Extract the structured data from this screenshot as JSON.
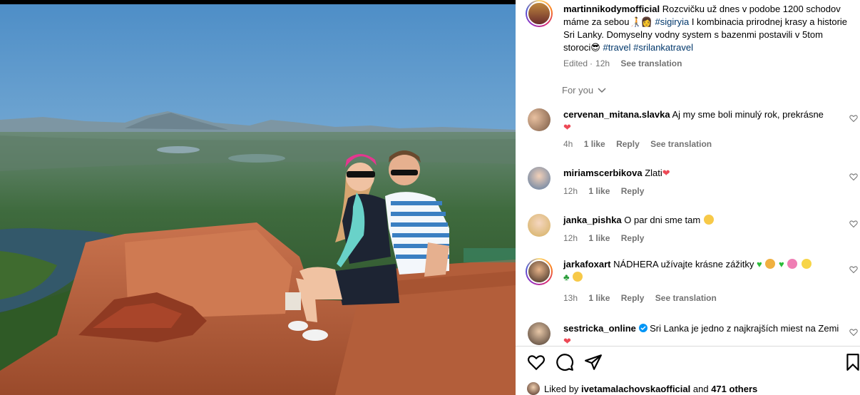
{
  "post": {
    "author": "martinnikodymofficial",
    "caption_part1": "Rozcvičku už dnes v podobe 1200 schodov máme za sebou",
    "caption_tag1": "#sigiryia",
    "caption_part2": "I kombinacia prirodnej krasy a historie Sri Lanky. Domyselny vodny system s bazenmi postavili v 5tom storoci",
    "caption_tag2": "#travel",
    "caption_tag3": "#srilankatravel",
    "edited_label": "Edited",
    "time": "12h",
    "see_translation": "See translation",
    "emoji_walkers": "🧑‍🦯",
    "emoji_woman": "👩",
    "emoji_cool": "😎"
  },
  "for_you_label": "For you",
  "comments": [
    {
      "username": "cervenan_mitana.slavka",
      "text": "Aj my sme boli minulý rok, prekrásne",
      "time": "4h",
      "likes": "1 like",
      "reply": "Reply",
      "translate": "See translation"
    },
    {
      "username": "miriamscerbikova",
      "text": "Zlati",
      "time": "12h",
      "likes": "1 like",
      "reply": "Reply"
    },
    {
      "username": "janka_pishka",
      "text": "O par dni sme tam",
      "time": "12h",
      "likes": "1 like",
      "reply": "Reply"
    },
    {
      "username": "jarkafoxart",
      "text": "NÁDHERA užívajte krásne zážitky",
      "time": "13h",
      "likes": "1 like",
      "reply": "Reply",
      "translate": "See translation"
    },
    {
      "username": "sestricka_online",
      "text": "Sri Lanka je jedno z najkrajších miest na Zemi",
      "verified": true
    }
  ],
  "liked_by": {
    "prefix": "Liked by",
    "user": "ivetamalachovskaofficial",
    "and": "and",
    "count": "471 others"
  },
  "icons": {
    "like": "heart-outline-icon",
    "comment": "comment-bubble-icon",
    "share": "paper-plane-icon",
    "save": "bookmark-icon"
  },
  "colors": {
    "link": "#00376b",
    "muted": "#737373",
    "heart": "#ed4956",
    "verified": "#0095f6"
  }
}
